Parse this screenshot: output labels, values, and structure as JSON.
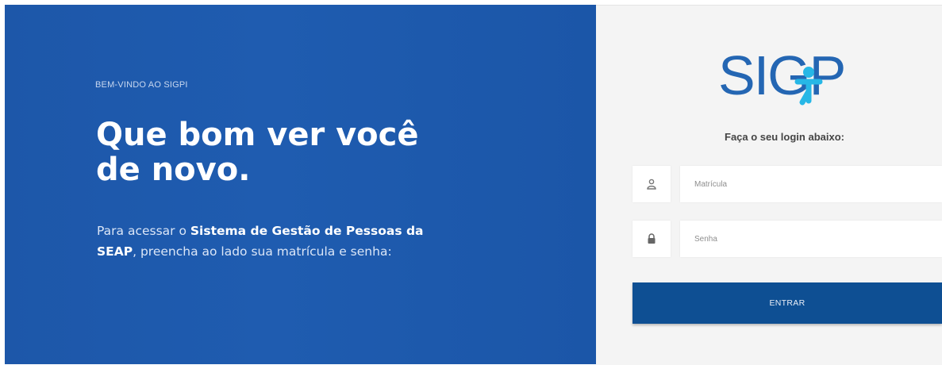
{
  "welcome": {
    "eyebrow": "BEM-VINDO AO SIGPI",
    "headline_line1": "Que bom ver você",
    "headline_line2": "de novo.",
    "description_prefix": "Para acessar o ",
    "description_system": "Sistema de Gestão de Pessoas da",
    "description_org": "SEAP",
    "description_suffix": ", preencha ao lado sua matrícula e senha:"
  },
  "login": {
    "logo_text": "SIGP",
    "title": "Faça o seu login abaixo:",
    "matricula_placeholder": "Matrícula",
    "senha_placeholder": "Senha",
    "submit_label": "ENTRAR"
  },
  "colors": {
    "brand_blue": "#1f5cb0",
    "button_blue": "#0e4f93",
    "logo_blue": "#2466b3",
    "logo_cyan": "#27b7e6"
  },
  "icons": {
    "matricula": "user-badge-icon",
    "senha": "lock-icon"
  }
}
